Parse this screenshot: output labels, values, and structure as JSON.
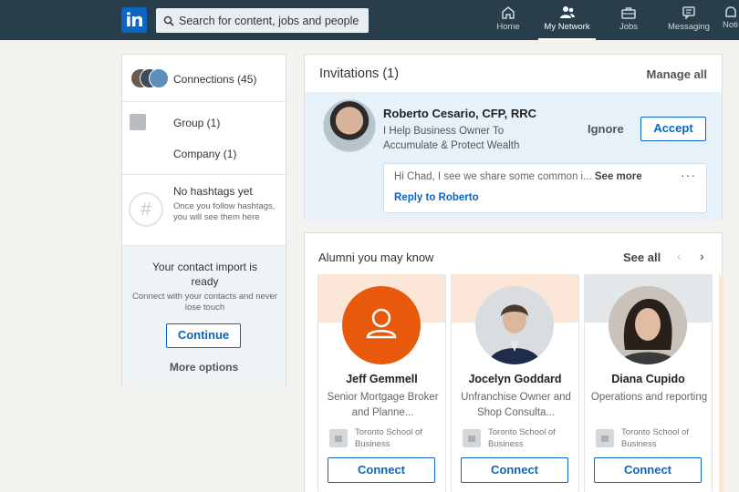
{
  "nav": {
    "logo_text": "in",
    "search_placeholder": "Search for content, jobs and people",
    "items": [
      {
        "label": "Home",
        "icon": "home-icon"
      },
      {
        "label": "My Network",
        "icon": "network-icon",
        "active": true
      },
      {
        "label": "Jobs",
        "icon": "briefcase-icon"
      },
      {
        "label": "Messaging",
        "icon": "messaging-icon"
      },
      {
        "label": "Noti",
        "icon": "notifications-icon"
      }
    ]
  },
  "sidebar": {
    "connections_label": "Connections (45)",
    "group_label": "Group (1)",
    "company_label": "Company (1)",
    "hashtags_title": "No hashtags yet",
    "hashtags_desc": "Once you follow hashtags, you will see them here",
    "hashtag_symbol": "#",
    "import_title": "Your contact import is ready",
    "import_desc": "Connect with your contacts and never lose touch",
    "continue_label": "Continue",
    "more_options_label": "More options"
  },
  "invitations": {
    "heading": "Invitations (1)",
    "manage_all_label": "Manage all",
    "invite": {
      "name": "Roberto Cesario, CFP, RRC",
      "headline": "I Help Business Owner To Accumulate & Protect Wealth",
      "ignore_label": "Ignore",
      "accept_label": "Accept",
      "message_preview": "Hi Chad, I see we share some common i...",
      "see_more_label": "See more",
      "more_actions_label": "···",
      "reply_label": "Reply to Roberto"
    }
  },
  "alumni": {
    "heading": "Alumni you may know",
    "see_all_label": "See all",
    "prev_label": "‹",
    "next_label": "›",
    "people": [
      {
        "name": "Jeff Gemmell",
        "title": "Senior Mortgage Broker and Planne...",
        "school": "Toronto School of Business",
        "connect_label": "Connect"
      },
      {
        "name": "Jocelyn Goddard",
        "title": "Unfranchise Owner and Shop Consulta...",
        "school": "Toronto School of Business",
        "connect_label": "Connect"
      },
      {
        "name": "Diana Cupido",
        "title": "Operations and reporting",
        "school": "Toronto School of Business",
        "connect_label": "Connect"
      }
    ]
  },
  "colors": {
    "nav_bg": "#283e4a",
    "brand_blue": "#0a66c2",
    "invite_bg": "#e6f1fa",
    "default_avatar_orange": "#e8590c",
    "banner_peach": "#fbe6d8",
    "banner_gray": "#e4e7ea"
  }
}
